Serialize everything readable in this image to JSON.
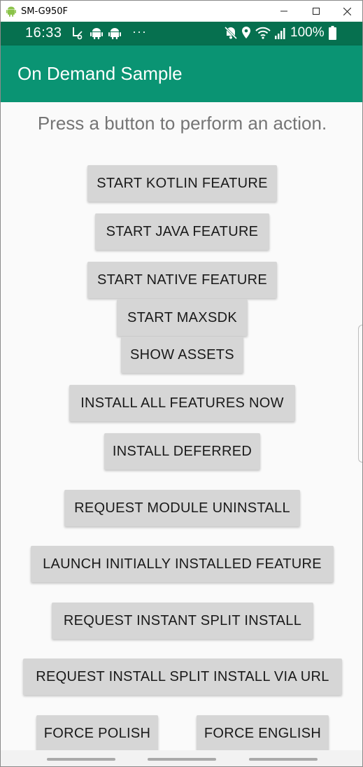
{
  "window": {
    "title": "SM-G950F"
  },
  "status_bar": {
    "time": "16:33",
    "dots": "···",
    "battery": "100%"
  },
  "app_bar": {
    "title": "On Demand Sample"
  },
  "content": {
    "instructions": "Press a button to perform an action.",
    "buttons": {
      "start_kotlin": "START KOTLIN FEATURE",
      "start_java": "START JAVA FEATURE",
      "start_native": "START NATIVE FEATURE",
      "start_maxsdk": "START MAXSDK",
      "show_assets": "SHOW ASSETS",
      "install_all": "INSTALL ALL FEATURES NOW",
      "install_deferred": "INSTALL DEFERRED",
      "request_uninstall": "REQUEST MODULE UNINSTALL",
      "launch_initial": "LAUNCH INITIALLY INSTALLED FEATURE",
      "request_instant": "REQUEST INSTANT SPLIT INSTALL",
      "request_url": "REQUEST INSTALL SPLIT INSTALL VIA URL",
      "force_polish": "FORCE POLISH",
      "force_english": "FORCE ENGLISH"
    }
  },
  "colors": {
    "status_bar": "#06704f",
    "app_bar": "#0a9473",
    "button": "#d6d6d6",
    "background": "#fafafa"
  }
}
